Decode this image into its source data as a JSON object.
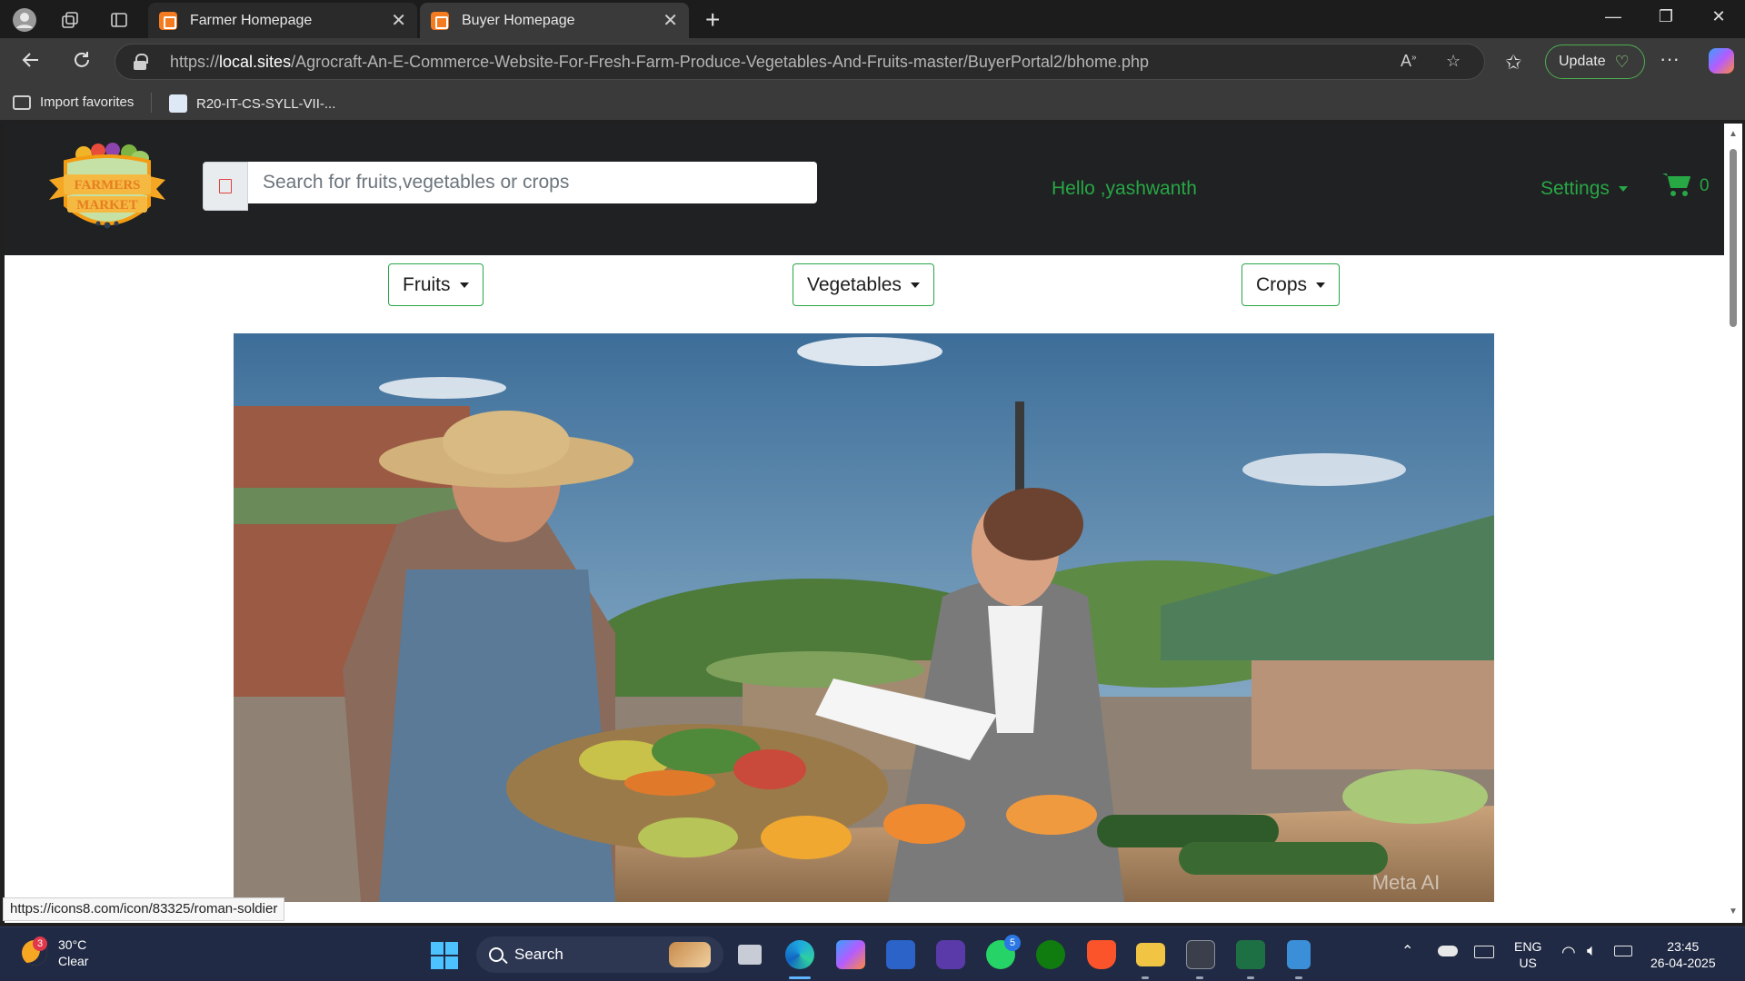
{
  "browser": {
    "tabs": [
      {
        "title": "Farmer Homepage",
        "active": false
      },
      {
        "title": "Buyer Homepage",
        "active": true
      }
    ],
    "url_prefix": "https://",
    "url_host": "local.sites",
    "url_path": "/Agrocraft-An-E-Commerce-Website-For-Fresh-Farm-Produce-Vegetables-And-Fruits-master/BuyerPortal2/bhome.php",
    "update_label": "Update",
    "favorites": [
      {
        "label": "Import favorites"
      },
      {
        "label": "R20-IT-CS-SYLL-VII-..."
      }
    ],
    "status_url": "https://icons8.com/icon/83325/roman-soldier"
  },
  "site": {
    "logo_line1": "FARMERS",
    "logo_line2": "MARKET",
    "search_placeholder": "Search for fruits,vegetables or crops",
    "greeting": "Hello ,yashwanth",
    "settings_label": "Settings",
    "cart_count": "0",
    "categories": [
      "Fruits",
      "Vegetables",
      "Crops"
    ],
    "hero_watermark": "Meta AI",
    "accent_color": "#28a745",
    "header_bg": "#1f2123"
  },
  "taskbar": {
    "weather_temp": "30°C",
    "weather_desc": "Clear",
    "weather_badge": "3",
    "search_label": "Search",
    "whatsapp_badge": "5",
    "lang_line1": "ENG",
    "lang_line2": "US",
    "time": "23:45",
    "date": "26-04-2025"
  }
}
